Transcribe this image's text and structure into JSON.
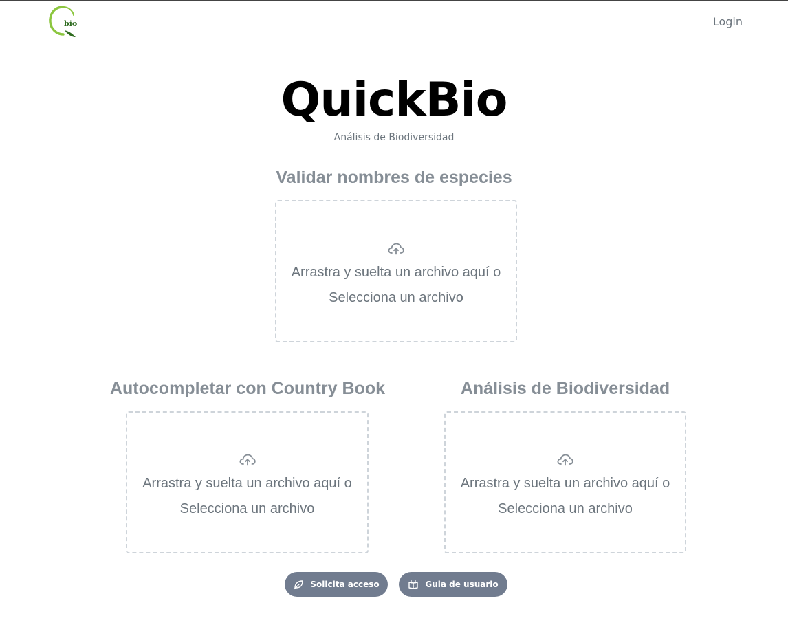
{
  "nav": {
    "logo_text": "bio",
    "login_label": "Login"
  },
  "hero": {
    "title": "QuickBio",
    "subtitle": "Análisis de Biodiversidad"
  },
  "uploads": [
    {
      "title": "Validar nombres de especies",
      "drop_text": "Arrastra y suelta un archivo aquí o",
      "select_label": "Selecciona un archivo",
      "icon": "cloud-upload-icon"
    },
    {
      "title": "Autocompletar con Country Book",
      "drop_text": "Arrastra y suelta un archivo aquí o",
      "select_label": "Selecciona un archivo",
      "icon": "cloud-upload-icon"
    },
    {
      "title": "Análisis de Biodiversidad",
      "drop_text": "Arrastra y suelta un archivo aquí o",
      "select_label": "Selecciona un archivo",
      "icon": "cloud-upload-icon"
    }
  ],
  "buttons": {
    "request_access": {
      "label": "Solicita acceso",
      "icon": "leaf-icon"
    },
    "user_guide": {
      "label": "Guia de usuario",
      "icon": "book-icon"
    }
  },
  "colors": {
    "logo_green": "#8cc63f",
    "logo_dark_green": "#2e6b1f",
    "muted_text": "#868e96",
    "button_bg": "#717c8f"
  }
}
